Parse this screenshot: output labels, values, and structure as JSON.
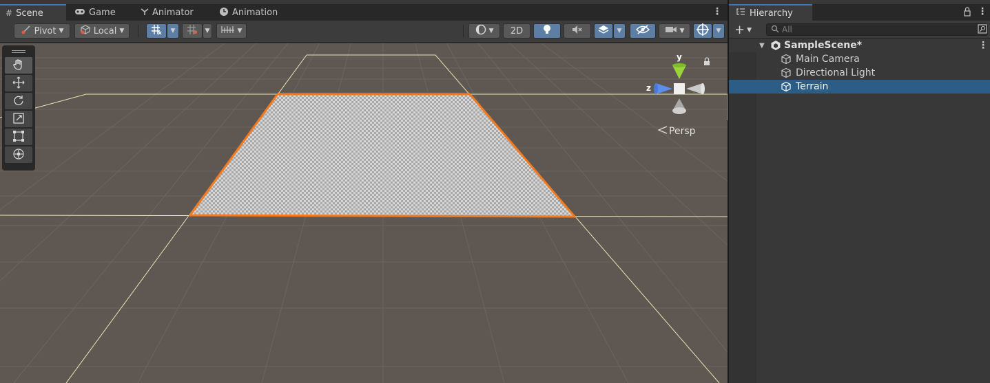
{
  "scene_view": {
    "tabs": [
      {
        "label": "Scene",
        "icon": "grid-icon",
        "active": true
      },
      {
        "label": "Game",
        "icon": "gamepad-icon",
        "active": false
      },
      {
        "label": "Animator",
        "icon": "animator-icon",
        "active": false
      },
      {
        "label": "Animation",
        "icon": "clock-icon",
        "active": false
      }
    ],
    "toolbar": {
      "pivot_label": "Pivot",
      "local_label": "Local",
      "mode_2d_label": "2D"
    },
    "gizmo": {
      "y_label": "y",
      "z_label": "z",
      "projection_label": "Persp"
    },
    "selection_color": "#f37a1e"
  },
  "hierarchy": {
    "title": "Hierarchy",
    "search_placeholder": "All",
    "scene_name": "SampleScene*",
    "items": [
      {
        "label": "Main Camera",
        "selected": false
      },
      {
        "label": "Directional Light",
        "selected": false
      },
      {
        "label": "Terrain",
        "selected": true
      }
    ],
    "selection_color": "#2c5d87"
  }
}
